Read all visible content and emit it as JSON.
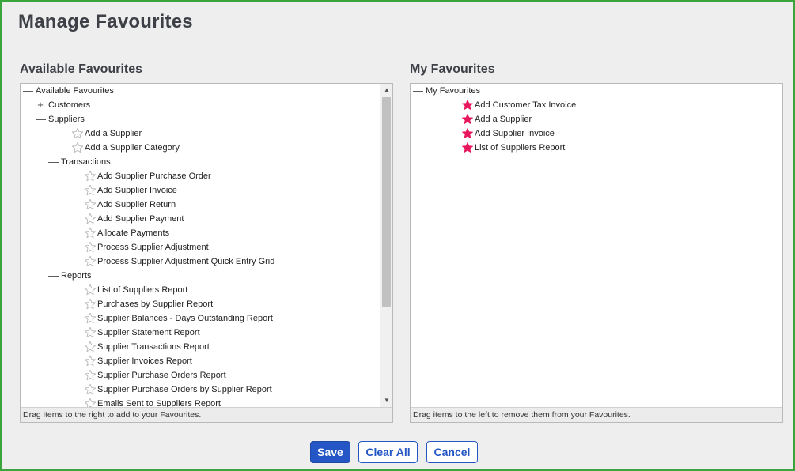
{
  "page": {
    "title": "Manage Favourites"
  },
  "available": {
    "heading": "Available Favourites",
    "hint": "Drag items to the right to add to your Favourites.",
    "rows": [
      {
        "label": "Available Favourites",
        "level": 0,
        "kind": "node",
        "toggle": "—"
      },
      {
        "label": "Customers",
        "level": 1,
        "kind": "node",
        "toggle": "+"
      },
      {
        "label": "Suppliers",
        "level": 1,
        "kind": "node",
        "toggle": "—"
      },
      {
        "label": "Add a Supplier",
        "level": 2,
        "kind": "leaf"
      },
      {
        "label": "Add a Supplier Category",
        "level": 2,
        "kind": "leaf"
      },
      {
        "label": "Transactions",
        "level": 2,
        "kind": "node",
        "toggle": "—"
      },
      {
        "label": "Add Supplier Purchase Order",
        "level": 3,
        "kind": "leaf"
      },
      {
        "label": "Add Supplier Invoice",
        "level": 3,
        "kind": "leaf"
      },
      {
        "label": "Add Supplier Return",
        "level": 3,
        "kind": "leaf"
      },
      {
        "label": "Add Supplier Payment",
        "level": 3,
        "kind": "leaf"
      },
      {
        "label": "Allocate Payments",
        "level": 3,
        "kind": "leaf"
      },
      {
        "label": "Process Supplier Adjustment",
        "level": 3,
        "kind": "leaf"
      },
      {
        "label": "Process Supplier Adjustment Quick Entry Grid",
        "level": 3,
        "kind": "leaf"
      },
      {
        "label": "Reports",
        "level": 2,
        "kind": "node",
        "toggle": "—"
      },
      {
        "label": "List of Suppliers Report",
        "level": 3,
        "kind": "leaf"
      },
      {
        "label": "Purchases by Supplier Report",
        "level": 3,
        "kind": "leaf"
      },
      {
        "label": "Supplier Balances - Days Outstanding Report",
        "level": 3,
        "kind": "leaf"
      },
      {
        "label": "Supplier Statement Report",
        "level": 3,
        "kind": "leaf"
      },
      {
        "label": "Supplier Transactions Report",
        "level": 3,
        "kind": "leaf"
      },
      {
        "label": "Supplier Invoices Report",
        "level": 3,
        "kind": "leaf"
      },
      {
        "label": "Supplier Purchase Orders Report",
        "level": 3,
        "kind": "leaf"
      },
      {
        "label": "Supplier Purchase Orders by Supplier Report",
        "level": 3,
        "kind": "leaf"
      },
      {
        "label": "Emails Sent to Suppliers Report",
        "level": 3,
        "kind": "leaf"
      }
    ]
  },
  "mine": {
    "heading": "My Favourites",
    "hint": "Drag items to the left to remove them from your Favourites.",
    "rows": [
      {
        "label": "My Favourites",
        "level": 0,
        "kind": "node",
        "toggle": "—"
      },
      {
        "label": "Add Customer Tax Invoice",
        "level": 2,
        "kind": "fav"
      },
      {
        "label": "Add a Supplier",
        "level": 2,
        "kind": "fav"
      },
      {
        "label": "Add Supplier Invoice",
        "level": 2,
        "kind": "fav"
      },
      {
        "label": "List of Suppliers Report",
        "level": 2,
        "kind": "fav"
      }
    ]
  },
  "buttons": {
    "save": "Save",
    "clear_all": "Clear All",
    "cancel": "Cancel"
  },
  "colors": {
    "accent": "#2457c5",
    "star_filled": "#e8175d",
    "star_empty": "#b8b8b8",
    "frame": "#3aa53a"
  },
  "icons": {
    "empty_star": "star-outline-icon",
    "filled_star": "star-filled-icon"
  }
}
